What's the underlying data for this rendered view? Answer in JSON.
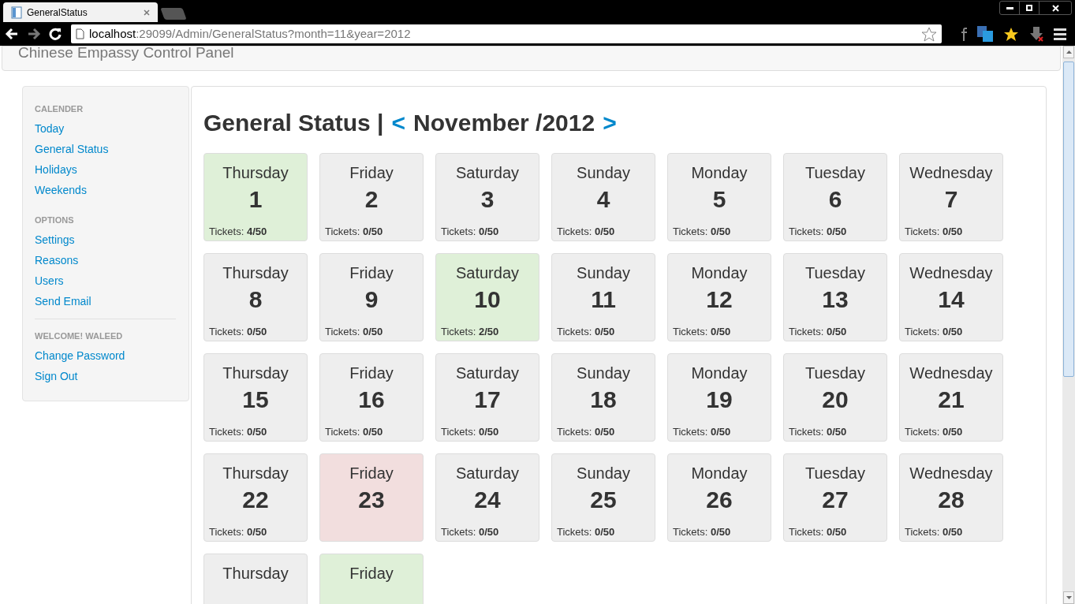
{
  "browser": {
    "tab_title": "GeneralStatus",
    "url_host": "localhost",
    "url_rest": ":29099/Admin/GeneralStatus?month=11&year=2012"
  },
  "header": {
    "title": "Chinese Empassy Control Panel"
  },
  "sidebar": {
    "sections": [
      {
        "heading": "CALENDER",
        "items": [
          "Today",
          "General Status",
          "Holidays",
          "Weekends"
        ]
      },
      {
        "heading": "OPTIONS",
        "items": [
          "Settings",
          "Reasons",
          "Users",
          "Send Email"
        ],
        "divider_after": true
      },
      {
        "heading": "WELCOME! WALEED",
        "items": [
          "Change Password",
          "Sign Out"
        ]
      }
    ]
  },
  "main": {
    "title": "General Status |",
    "prev": "<",
    "month": "November /2012",
    "next": ">"
  },
  "days": [
    {
      "weekday": "Thursday",
      "day": "1",
      "tickets_label": "Tickets:",
      "tickets": "4/50",
      "color": "#dff0d8"
    },
    {
      "weekday": "Friday",
      "day": "2",
      "tickets_label": "Tickets:",
      "tickets": "0/50",
      "color": "#eeeeee"
    },
    {
      "weekday": "Saturday",
      "day": "3",
      "tickets_label": "Tickets:",
      "tickets": "0/50",
      "color": "#eeeeee"
    },
    {
      "weekday": "Sunday",
      "day": "4",
      "tickets_label": "Tickets:",
      "tickets": "0/50",
      "color": "#eeeeee"
    },
    {
      "weekday": "Monday",
      "day": "5",
      "tickets_label": "Tickets:",
      "tickets": "0/50",
      "color": "#eeeeee"
    },
    {
      "weekday": "Tuesday",
      "day": "6",
      "tickets_label": "Tickets:",
      "tickets": "0/50",
      "color": "#eeeeee"
    },
    {
      "weekday": "Wednesday",
      "day": "7",
      "tickets_label": "Tickets:",
      "tickets": "0/50",
      "color": "#eeeeee"
    },
    {
      "weekday": "Thursday",
      "day": "8",
      "tickets_label": "Tickets:",
      "tickets": "0/50",
      "color": "#eeeeee"
    },
    {
      "weekday": "Friday",
      "day": "9",
      "tickets_label": "Tickets:",
      "tickets": "0/50",
      "color": "#eeeeee"
    },
    {
      "weekday": "Saturday",
      "day": "10",
      "tickets_label": "Tickets:",
      "tickets": "2/50",
      "color": "#dff0d8"
    },
    {
      "weekday": "Sunday",
      "day": "11",
      "tickets_label": "Tickets:",
      "tickets": "0/50",
      "color": "#eeeeee"
    },
    {
      "weekday": "Monday",
      "day": "12",
      "tickets_label": "Tickets:",
      "tickets": "0/50",
      "color": "#eeeeee"
    },
    {
      "weekday": "Tuesday",
      "day": "13",
      "tickets_label": "Tickets:",
      "tickets": "0/50",
      "color": "#eeeeee"
    },
    {
      "weekday": "Wednesday",
      "day": "14",
      "tickets_label": "Tickets:",
      "tickets": "0/50",
      "color": "#eeeeee"
    },
    {
      "weekday": "Thursday",
      "day": "15",
      "tickets_label": "Tickets:",
      "tickets": "0/50",
      "color": "#eeeeee"
    },
    {
      "weekday": "Friday",
      "day": "16",
      "tickets_label": "Tickets:",
      "tickets": "0/50",
      "color": "#eeeeee"
    },
    {
      "weekday": "Saturday",
      "day": "17",
      "tickets_label": "Tickets:",
      "tickets": "0/50",
      "color": "#eeeeee"
    },
    {
      "weekday": "Sunday",
      "day": "18",
      "tickets_label": "Tickets:",
      "tickets": "0/50",
      "color": "#eeeeee"
    },
    {
      "weekday": "Monday",
      "day": "19",
      "tickets_label": "Tickets:",
      "tickets": "0/50",
      "color": "#eeeeee"
    },
    {
      "weekday": "Tuesday",
      "day": "20",
      "tickets_label": "Tickets:",
      "tickets": "0/50",
      "color": "#eeeeee"
    },
    {
      "weekday": "Wednesday",
      "day": "21",
      "tickets_label": "Tickets:",
      "tickets": "0/50",
      "color": "#eeeeee"
    },
    {
      "weekday": "Thursday",
      "day": "22",
      "tickets_label": "Tickets:",
      "tickets": "0/50",
      "color": "#eeeeee"
    },
    {
      "weekday": "Friday",
      "day": "23",
      "color": "#f2dede"
    },
    {
      "weekday": "Saturday",
      "day": "24",
      "tickets_label": "Tickets:",
      "tickets": "0/50",
      "color": "#eeeeee"
    },
    {
      "weekday": "Sunday",
      "day": "25",
      "tickets_label": "Tickets:",
      "tickets": "0/50",
      "color": "#eeeeee"
    },
    {
      "weekday": "Monday",
      "day": "26",
      "tickets_label": "Tickets:",
      "tickets": "0/50",
      "color": "#eeeeee"
    },
    {
      "weekday": "Tuesday",
      "day": "27",
      "tickets_label": "Tickets:",
      "tickets": "0/50",
      "color": "#eeeeee"
    },
    {
      "weekday": "Wednesday",
      "day": "28",
      "tickets_label": "Tickets:",
      "tickets": "0/50",
      "color": "#eeeeee"
    },
    {
      "weekday": "Thursday",
      "color": "#eeeeee"
    },
    {
      "weekday": "Friday",
      "color": "#dff0d8"
    }
  ]
}
